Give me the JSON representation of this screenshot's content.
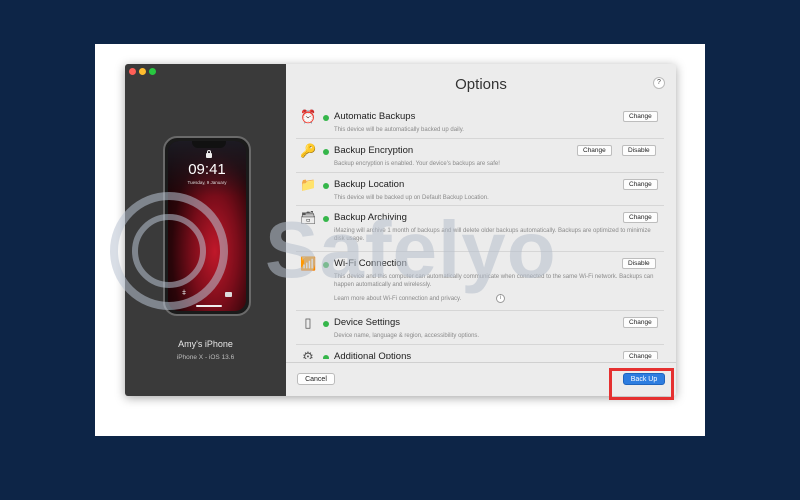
{
  "window": {
    "title": "Options",
    "help_label": "?"
  },
  "device": {
    "time": "09:41",
    "date": "Tuesday, 9 January",
    "name": "Amy's iPhone",
    "model": "iPhone X - iOS 13.6"
  },
  "options": [
    {
      "title": "Automatic Backups",
      "icon": "alarm-clock-icon",
      "desc": "This device will be automatically backed up daily.",
      "buttons": [
        "Change"
      ]
    },
    {
      "title": "Backup Encryption",
      "icon": "key-icon",
      "desc": "Backup encryption is enabled. Your device's backups are safe!",
      "buttons": [
        "Change",
        "Disable"
      ]
    },
    {
      "title": "Backup Location",
      "icon": "folder-icon",
      "desc": "This device will be backed up on Default Backup Location.",
      "buttons": [
        "Change"
      ]
    },
    {
      "title": "Backup Archiving",
      "icon": "archive-box-icon",
      "desc": "iMazing will archive 1 month of backups and will delete older backups automatically. Backups are optimized to minimize disk usage.",
      "buttons": [
        "Change"
      ]
    },
    {
      "title": "Wi-Fi Connection",
      "icon": "wifi-icon",
      "desc": "This device and this computer can automatically communicate when connected to the same Wi-Fi network. Backups can happen automatically and wirelessly.",
      "link": "Learn more about Wi-Fi connection and privacy.",
      "buttons": [
        "Disable"
      ]
    },
    {
      "title": "Device Settings",
      "icon": "phone-icon",
      "desc": "Device name, language & region, accessibility options.",
      "buttons": [
        "Change"
      ]
    },
    {
      "title": "Additional Options",
      "icon": "gear-icon",
      "desc": "",
      "buttons": [
        "Change"
      ]
    }
  ],
  "footer": {
    "cancel_label": "Cancel",
    "backup_label": "Back Up"
  },
  "watermark": {
    "text": "Safelyo"
  },
  "colors": {
    "background": "#0d2547",
    "status_dot": "#35b64a",
    "primary_button": "#2d7de0",
    "highlight": "#e53030"
  }
}
